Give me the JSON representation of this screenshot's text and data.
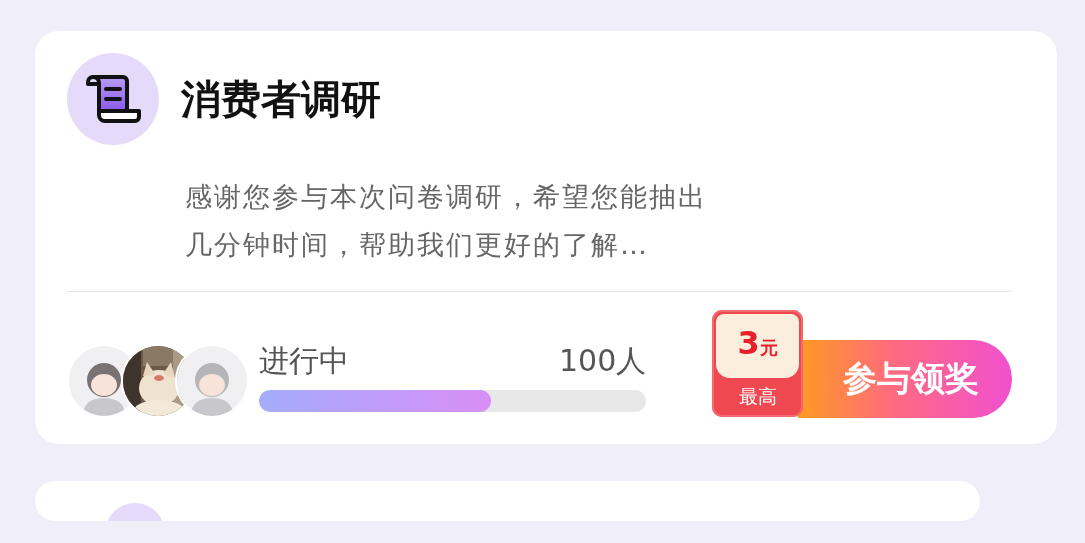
{
  "survey_card": {
    "title": "消费者调研",
    "description": "感谢您参与本次问卷调研，希望您能抽出几分钟时间，帮助我们更好的了解…",
    "status": "进行中",
    "participants": "100人",
    "progress": {
      "level": 0.6
    },
    "reward": {
      "amount": "3",
      "unit": "元",
      "label": "最高"
    },
    "action_button": "参与领奖",
    "avatars": [
      {
        "kind": "figure"
      },
      {
        "kind": "picture"
      },
      {
        "kind": "hooded"
      }
    ]
  }
}
